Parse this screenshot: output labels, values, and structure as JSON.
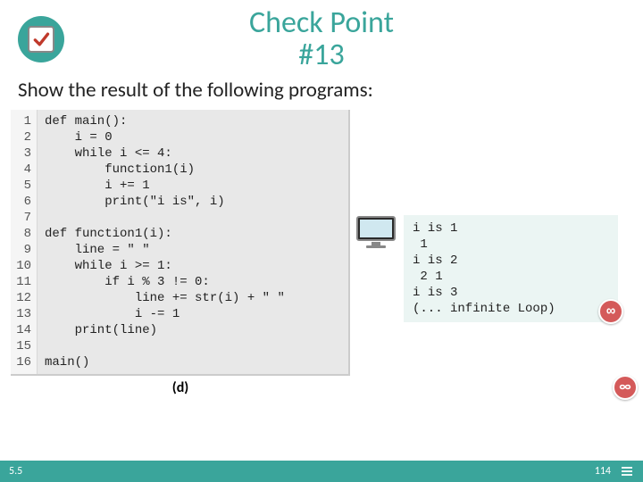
{
  "header": {
    "title_line1": "Check Point",
    "title_line2": "#13"
  },
  "prompt": "Show the result of the following programs:",
  "code": {
    "line_numbers": [
      "1",
      "2",
      "3",
      "4",
      "5",
      "6",
      "7",
      "8",
      "9",
      "10",
      "11",
      "12",
      "13",
      "14",
      "15",
      "16"
    ],
    "lines": [
      "def main():",
      "    i = 0",
      "    while i <= 4:",
      "        function1(i)",
      "        i += 1",
      "        print(\"i is\", i)",
      "",
      "def function1(i):",
      "    line = \" \"",
      "    while i >= 1:",
      "        if i % 3 != 0:",
      "            line += str(i) + \" \"",
      "            i -= 1",
      "    print(line)",
      "",
      "main()"
    ],
    "figure_label": "(d)"
  },
  "output": {
    "lines": [
      "i is 1",
      " 1",
      "i is 2",
      " 2 1",
      "i is 3",
      "(... infinite Loop)"
    ]
  },
  "icons": {
    "infinity_glyph": "∞"
  },
  "footer": {
    "section": "5.5",
    "page": "114"
  }
}
